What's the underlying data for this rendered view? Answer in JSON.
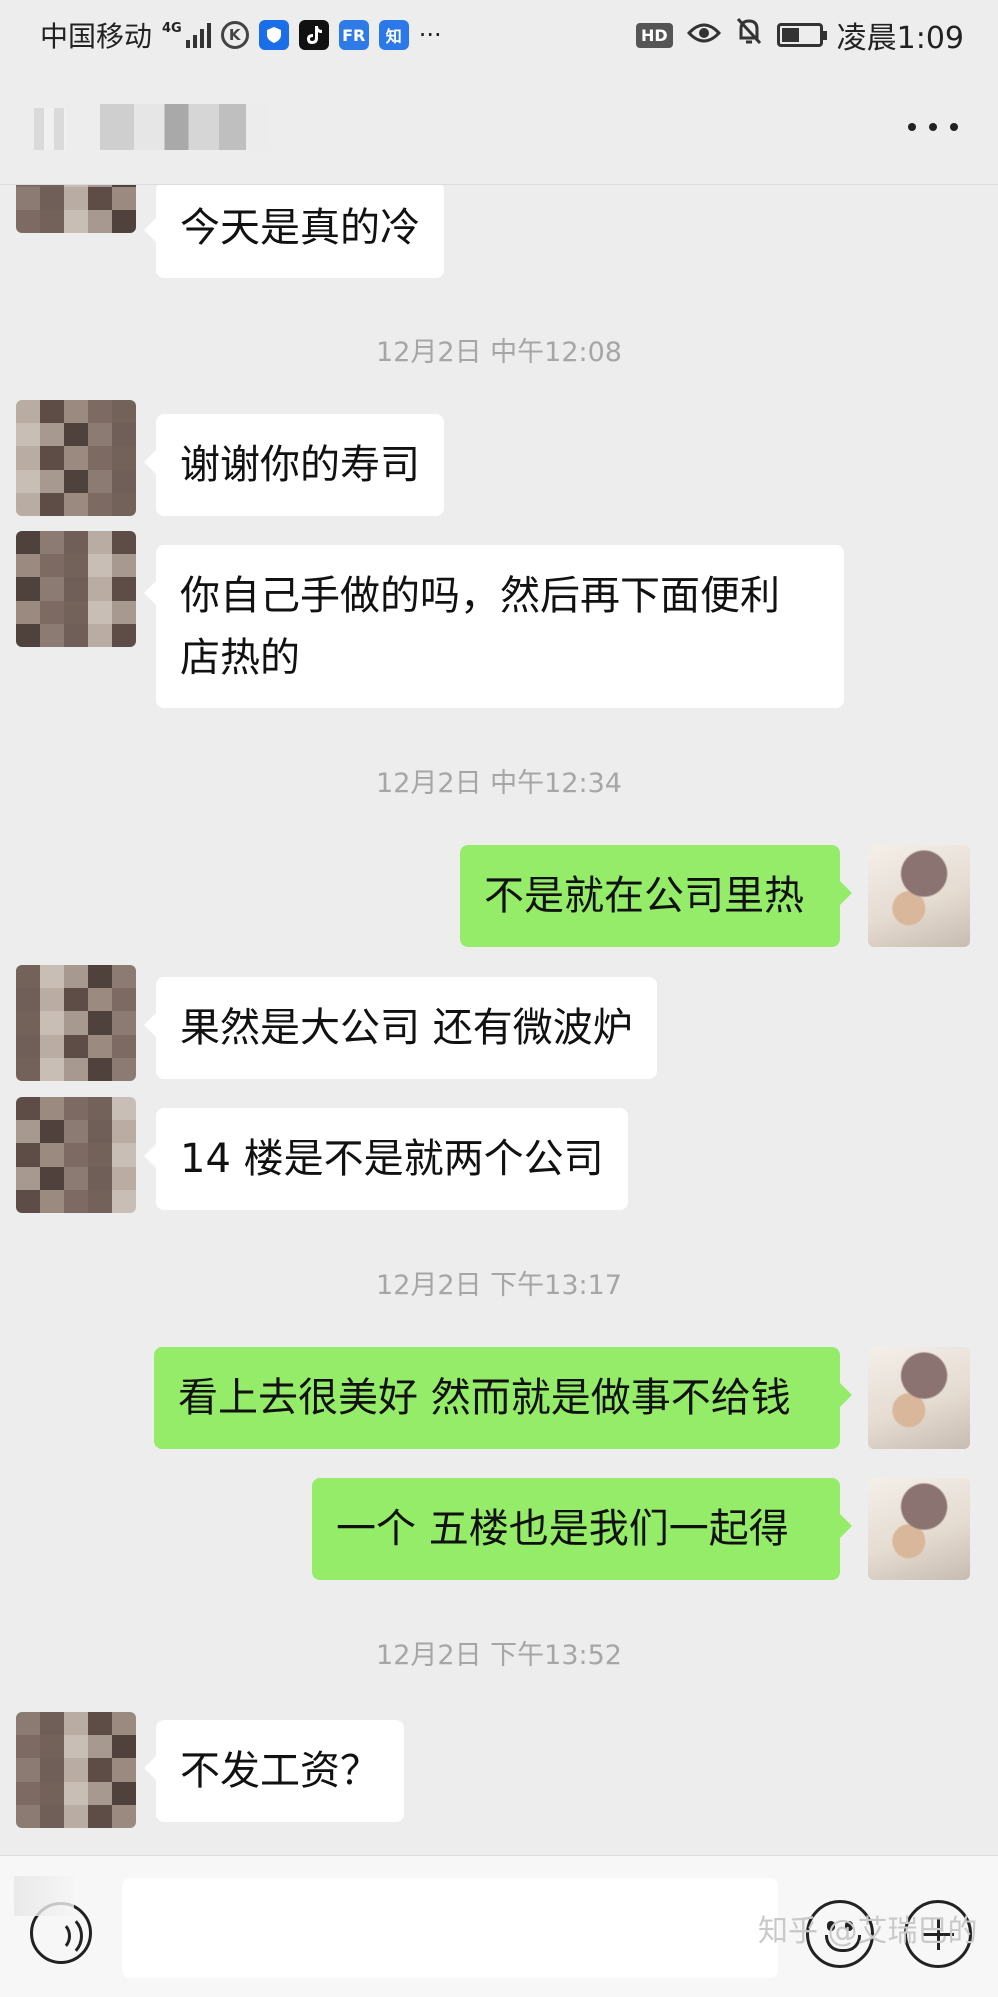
{
  "status_bar": {
    "carrier": "中国移动",
    "network": "4G",
    "apps": [
      {
        "icon": "k-app-icon",
        "label": "K"
      },
      {
        "icon": "shield-app-icon",
        "label": "",
        "color": "#1a6ee8"
      },
      {
        "icon": "tiktok-app-icon",
        "label": "",
        "color": "#111111"
      },
      {
        "icon": "fr-app-icon",
        "label": "FR",
        "color": "#2e7be8"
      },
      {
        "icon": "zhihu-app-icon",
        "label": "知",
        "color": "#2b79e8"
      }
    ],
    "overflow": "···",
    "hd_badge": "HD",
    "battery_level": 0.45,
    "time": "凌晨1:09"
  },
  "chat_header": {
    "contact_name_blurred": true
  },
  "messages": [
    {
      "type": "in",
      "text": "今天是真的冷"
    },
    {
      "type": "time",
      "text": "12月2日 中午12:08"
    },
    {
      "type": "in",
      "text": "谢谢你的寿司"
    },
    {
      "type": "in",
      "lines": [
        "你自己手做的吗，然后再下面便利",
        "店热的"
      ]
    },
    {
      "type": "time",
      "text": "12月2日 中午12:34"
    },
    {
      "type": "out",
      "text": "不是就在公司里热"
    },
    {
      "type": "in",
      "text": "果然是大公司  还有微波炉"
    },
    {
      "type": "in",
      "text": "14 楼是不是就两个公司"
    },
    {
      "type": "time",
      "text": "12月2日 下午13:17"
    },
    {
      "type": "out",
      "text": "看上去很美好  然而就是做事不给钱"
    },
    {
      "type": "out",
      "text": "一个  五楼也是我们一起得"
    },
    {
      "type": "time",
      "text": "12月2日 下午13:52"
    },
    {
      "type": "in",
      "text": "不发工资？"
    }
  ],
  "input_bar": {
    "text_value": "",
    "watermark": "知乎 @艾瑞巴的"
  },
  "colors": {
    "background": "#ededed",
    "incoming_bubble": "#ffffff",
    "outgoing_bubble": "#95ec69",
    "timestamp": "#a6a6a6"
  }
}
